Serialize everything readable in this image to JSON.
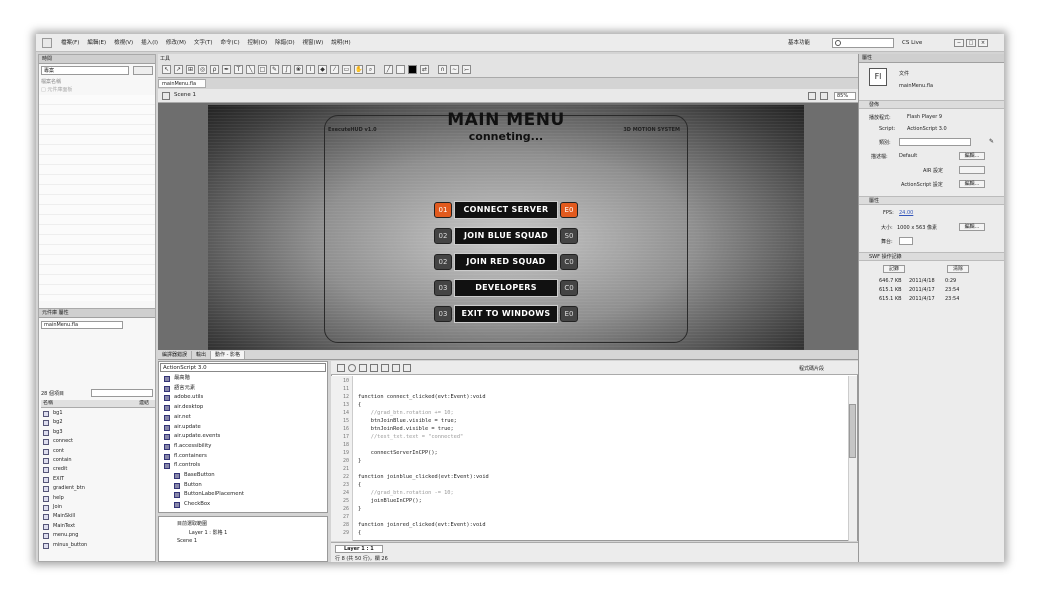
{
  "menubar": {
    "items": [
      "檔案(F)",
      "編輯(E)",
      "檢視(V)",
      "插入(I)",
      "修改(M)",
      "文字(T)",
      "命令(C)",
      "控制(O)",
      "除錯(D)",
      "視窗(W)",
      "說明(H)"
    ],
    "workspace": "基本功能",
    "search_placeholder": "",
    "cs_live": "CS Live"
  },
  "library": {
    "tab": "時間",
    "combo": "專案",
    "items": [
      "檔案名稱",
      "□ 元件庫面板"
    ]
  },
  "doclib": {
    "tabs": [
      "元件庫",
      "屬性"
    ],
    "file": "mainMenu.fla",
    "count": "28 個項目",
    "col": "名稱",
    "link": "連結",
    "items": [
      "bg1",
      "bg2",
      "bg3",
      "connect",
      "cont",
      "contain",
      "credit",
      "EXIT",
      "gradient_btn",
      "help",
      "Join",
      "MainSkill",
      "MainText",
      "menu.png",
      "minus_button"
    ]
  },
  "tools": {
    "label": "工具"
  },
  "doc": {
    "tab": "mainMenu.fla",
    "scene": "Scene 1",
    "zoom": "85%"
  },
  "stage": {
    "title": "MAIN MENU",
    "subtitle": "conneting...",
    "version": "ExecuteHUD v1.0",
    "motion": "3D MOTION SYSTEM",
    "buttons": [
      {
        "num": "01",
        "label": "CONNECT SERVER",
        "code": "E0"
      },
      {
        "num": "02",
        "label": "JOIN BLUE SQUAD",
        "code": "S0"
      },
      {
        "num": "02",
        "label": "JOIN RED SQUAD",
        "code": "C0"
      },
      {
        "num": "03",
        "label": "DEVELOPERS",
        "code": "C0"
      },
      {
        "num": "03",
        "label": "EXIT TO WINDOWS",
        "code": "E0"
      }
    ]
  },
  "bottom": {
    "tabs": [
      "編譯器錯誤",
      "輸出",
      "動作 - 影格"
    ],
    "as_version": "ActionScript 3.0",
    "as_items": [
      "最高階",
      "語言元素",
      "adobe.utils",
      "air.desktop",
      "air.net",
      "air.update",
      "air.update.events",
      "fl.accessibility",
      "fl.containers",
      "fl.controls",
      "BaseButton",
      "Button",
      "ButtonLabelPlacement",
      "CheckBox"
    ],
    "tree": [
      "目前選取範圍",
      "Layer 1 : 影格 1",
      "Scene 1"
    ],
    "code_assist": "程式碼片段",
    "layer_tab": "Layer 1 : 1",
    "status": "行 8 (共 50 行)，欄 26",
    "lines": [
      {
        "n": "10",
        "t": ""
      },
      {
        "n": "11",
        "t": ""
      },
      {
        "n": "12",
        "t": "function connect_clicked(evt:Event):void"
      },
      {
        "n": "13",
        "t": "{"
      },
      {
        "n": "14",
        "t": "    //grad_btn.rotation += 10;"
      },
      {
        "n": "15",
        "t": "    btnJoinBlue.visible = true;"
      },
      {
        "n": "16",
        "t": "    btnJoinRed.visible = true;"
      },
      {
        "n": "17",
        "t": "    //test_txt.text = \"connected\""
      },
      {
        "n": "18",
        "t": ""
      },
      {
        "n": "19",
        "t": "    connectServerInCPP();"
      },
      {
        "n": "20",
        "t": "}"
      },
      {
        "n": "21",
        "t": ""
      },
      {
        "n": "22",
        "t": "function joinblue_clicked(evt:Event):void"
      },
      {
        "n": "23",
        "t": "{"
      },
      {
        "n": "24",
        "t": "    //grad_btn.rotation -= 10;"
      },
      {
        "n": "25",
        "t": "    joinBlueInCPP();"
      },
      {
        "n": "26",
        "t": "}"
      },
      {
        "n": "27",
        "t": ""
      },
      {
        "n": "28",
        "t": "function joinred_clicked(evt:Event):void"
      },
      {
        "n": "29",
        "t": "{"
      }
    ]
  },
  "props": {
    "tab": "屬性",
    "doc_label": "文件",
    "file": "mainMenu.fla",
    "fl": "Fl",
    "publish": "發佈",
    "player_label": "播放程式:",
    "player": "Flash Player 9",
    "script_label": "Script:",
    "script": "ActionScript 3.0",
    "class_label": "類別:",
    "profile_label": "描述檔:",
    "profile": "Default",
    "edit": "編輯...",
    "air": "AIR 設定",
    "as_settings": "ActionScript 設定",
    "props_sec": "屬性",
    "fps_label": "FPS:",
    "fps": "24.00",
    "size_label": "大小:",
    "size": "1000 x 563 像素",
    "stage_label": "舞台:",
    "history_sec": "SWF 操作記錄",
    "log": "記錄",
    "clear": "清除",
    "history": [
      {
        "size": "646.7 KB",
        "date": "2011/4/18",
        "time": "0:29"
      },
      {
        "size": "615.1 KB",
        "date": "2011/4/17",
        "time": "23:54"
      },
      {
        "size": "615.1 KB",
        "date": "2011/4/17",
        "time": "23:54"
      }
    ]
  },
  "colors": {
    "accent": "#e25a1e"
  }
}
